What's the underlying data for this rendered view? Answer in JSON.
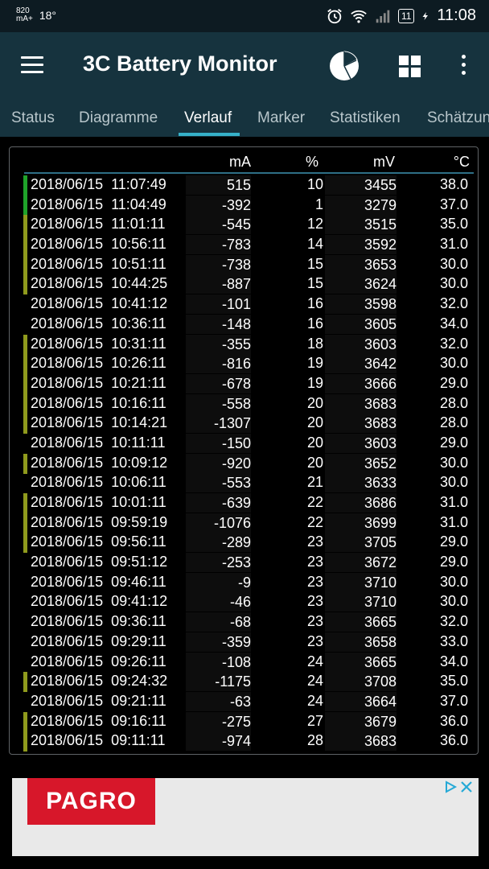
{
  "statusbar": {
    "current_value": "820",
    "current_unit": "mA+",
    "temperature": "18°",
    "battery_level": "11",
    "time": "11:08"
  },
  "appbar": {
    "title": "3C Battery Monitor"
  },
  "tabs": [
    "Status",
    "Diagramme",
    "Verlauf",
    "Marker",
    "Statistiken",
    "Schätzungen"
  ],
  "active_tab": "Verlauf",
  "table": {
    "headers": {
      "ma": "mA",
      "percent": "%",
      "mv": "mV",
      "temp": "°C"
    },
    "rows": [
      {
        "date": "2018/06/15  11:07:49",
        "ma": "515",
        "pct": "10",
        "mv": "3455",
        "temp": "38.0",
        "marker": "#1fa32a"
      },
      {
        "date": "2018/06/15  11:04:49",
        "ma": "-392",
        "pct": "1",
        "mv": "3279",
        "temp": "37.0",
        "marker": "#1fa32a"
      },
      {
        "date": "2018/06/15  11:01:11",
        "ma": "-545",
        "pct": "12",
        "mv": "3515",
        "temp": "35.0",
        "marker": "#8f9a1d"
      },
      {
        "date": "2018/06/15  10:56:11",
        "ma": "-783",
        "pct": "14",
        "mv": "3592",
        "temp": "31.0",
        "marker": "#8f9a1d"
      },
      {
        "date": "2018/06/15  10:51:11",
        "ma": "-738",
        "pct": "15",
        "mv": "3653",
        "temp": "30.0",
        "marker": "#8f9a1d"
      },
      {
        "date": "2018/06/15  10:44:25",
        "ma": "-887",
        "pct": "15",
        "mv": "3624",
        "temp": "30.0",
        "marker": "#8f9a1d"
      },
      {
        "date": "2018/06/15  10:41:12",
        "ma": "-101",
        "pct": "16",
        "mv": "3598",
        "temp": "32.0",
        "marker": ""
      },
      {
        "date": "2018/06/15  10:36:11",
        "ma": "-148",
        "pct": "16",
        "mv": "3605",
        "temp": "34.0",
        "marker": ""
      },
      {
        "date": "2018/06/15  10:31:11",
        "ma": "-355",
        "pct": "18",
        "mv": "3603",
        "temp": "32.0",
        "marker": "#8f9a1d"
      },
      {
        "date": "2018/06/15  10:26:11",
        "ma": "-816",
        "pct": "19",
        "mv": "3642",
        "temp": "30.0",
        "marker": "#8f9a1d"
      },
      {
        "date": "2018/06/15  10:21:11",
        "ma": "-678",
        "pct": "19",
        "mv": "3666",
        "temp": "29.0",
        "marker": "#8f9a1d"
      },
      {
        "date": "2018/06/15  10:16:11",
        "ma": "-558",
        "pct": "20",
        "mv": "3683",
        "temp": "28.0",
        "marker": "#8f9a1d"
      },
      {
        "date": "2018/06/15  10:14:21",
        "ma": "-1307",
        "pct": "20",
        "mv": "3683",
        "temp": "28.0",
        "marker": "#8f9a1d"
      },
      {
        "date": "2018/06/15  10:11:11",
        "ma": "-150",
        "pct": "20",
        "mv": "3603",
        "temp": "29.0",
        "marker": ""
      },
      {
        "date": "2018/06/15  10:09:12",
        "ma": "-920",
        "pct": "20",
        "mv": "3652",
        "temp": "30.0",
        "marker": "#8f9a1d"
      },
      {
        "date": "2018/06/15  10:06:11",
        "ma": "-553",
        "pct": "21",
        "mv": "3633",
        "temp": "30.0",
        "marker": ""
      },
      {
        "date": "2018/06/15  10:01:11",
        "ma": "-639",
        "pct": "22",
        "mv": "3686",
        "temp": "31.0",
        "marker": "#8f9a1d"
      },
      {
        "date": "2018/06/15  09:59:19",
        "ma": "-1076",
        "pct": "22",
        "mv": "3699",
        "temp": "31.0",
        "marker": "#8f9a1d"
      },
      {
        "date": "2018/06/15  09:56:11",
        "ma": "-289",
        "pct": "23",
        "mv": "3705",
        "temp": "29.0",
        "marker": "#8f9a1d"
      },
      {
        "date": "2018/06/15  09:51:12",
        "ma": "-253",
        "pct": "23",
        "mv": "3672",
        "temp": "29.0",
        "marker": ""
      },
      {
        "date": "2018/06/15  09:46:11",
        "ma": "-9",
        "pct": "23",
        "mv": "3710",
        "temp": "30.0",
        "marker": ""
      },
      {
        "date": "2018/06/15  09:41:12",
        "ma": "-46",
        "pct": "23",
        "mv": "3710",
        "temp": "30.0",
        "marker": ""
      },
      {
        "date": "2018/06/15  09:36:11",
        "ma": "-68",
        "pct": "23",
        "mv": "3665",
        "temp": "32.0",
        "marker": ""
      },
      {
        "date": "2018/06/15  09:29:11",
        "ma": "-359",
        "pct": "23",
        "mv": "3658",
        "temp": "33.0",
        "marker": ""
      },
      {
        "date": "2018/06/15  09:26:11",
        "ma": "-108",
        "pct": "24",
        "mv": "3665",
        "temp": "34.0",
        "marker": ""
      },
      {
        "date": "2018/06/15  09:24:32",
        "ma": "-1175",
        "pct": "24",
        "mv": "3708",
        "temp": "35.0",
        "marker": "#8f9a1d"
      },
      {
        "date": "2018/06/15  09:21:11",
        "ma": "-63",
        "pct": "24",
        "mv": "3664",
        "temp": "37.0",
        "marker": ""
      },
      {
        "date": "2018/06/15  09:16:11",
        "ma": "-275",
        "pct": "27",
        "mv": "3679",
        "temp": "36.0",
        "marker": "#8f9a1d"
      },
      {
        "date": "2018/06/15  09:11:11",
        "ma": "-974",
        "pct": "28",
        "mv": "3683",
        "temp": "36.0",
        "marker": "#8f9a1d"
      }
    ]
  },
  "ad": {
    "brand": "PAGRO"
  },
  "colors": {
    "appbar": "#16333e",
    "statusbar": "#0d1b22",
    "accent": "#36b1c9",
    "marker_green": "#1fa32a",
    "marker_olive": "#8f9a1d"
  }
}
